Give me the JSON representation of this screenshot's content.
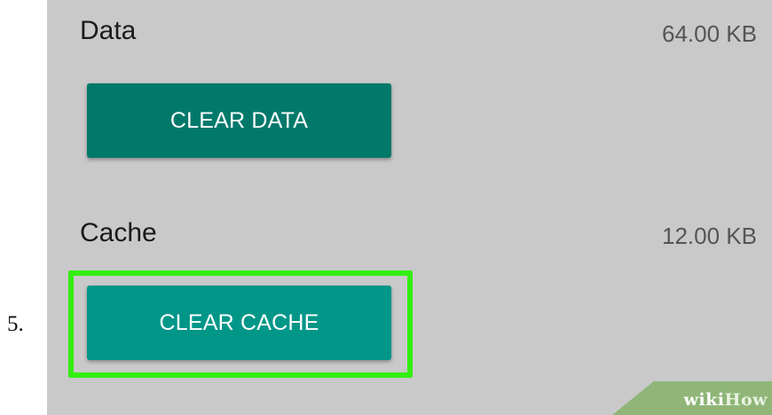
{
  "step": {
    "number": "5."
  },
  "storage": {
    "data": {
      "label": "Data",
      "size": "64.00 KB",
      "button_label": "CLEAR DATA"
    },
    "cache": {
      "label": "Cache",
      "size": "12.00 KB",
      "button_label": "CLEAR CACHE"
    }
  },
  "watermark": {
    "part1": "wiki",
    "part2": "How"
  },
  "colors": {
    "screen_background": "#c9c9c9",
    "clear_data_button": "#00796b",
    "clear_cache_button": "#009688",
    "highlight_border": "#33ee11",
    "watermark_background": "#8fb678"
  }
}
